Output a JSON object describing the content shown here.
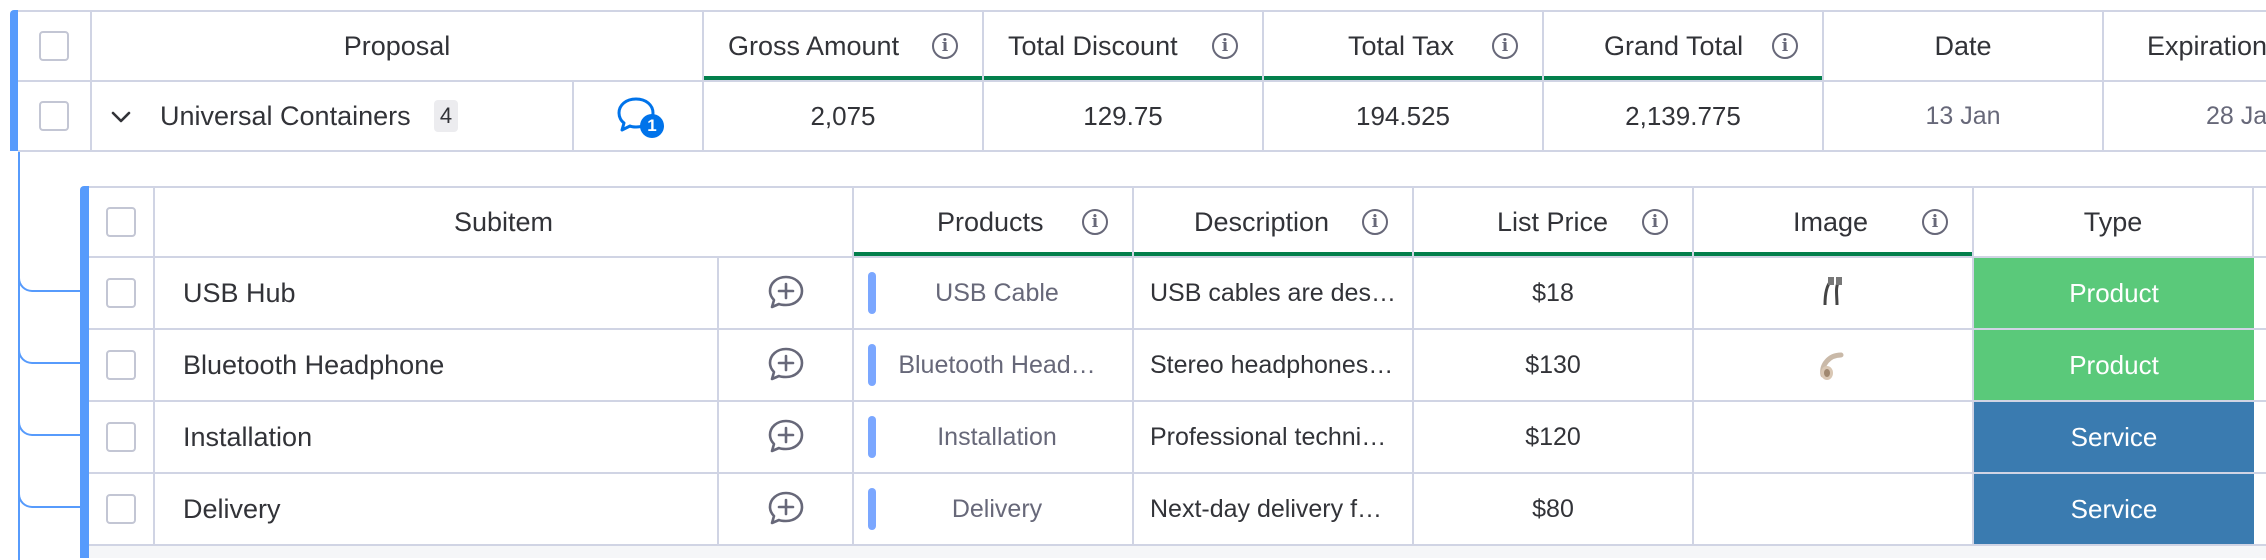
{
  "parent_table": {
    "headers": {
      "proposal": "Proposal",
      "gross_amount": "Gross Amount",
      "total_discount": "Total Discount",
      "total_tax": "Total Tax",
      "grand_total": "Grand Total",
      "date": "Date",
      "expiration": "Expiration"
    },
    "row": {
      "name": "Universal Containers",
      "subitem_count": "4",
      "updates_count": "1",
      "gross_amount": "2,075",
      "total_discount": "129.75",
      "total_tax": "194.525",
      "grand_total": "2,139.775",
      "date": "13 Jan",
      "expiration": "28 Ja"
    }
  },
  "sub_table": {
    "headers": {
      "subitem": "Subitem",
      "products": "Products",
      "description": "Description",
      "list_price": "List Price",
      "image": "Image",
      "type": "Type"
    },
    "rows": [
      {
        "name": "USB Hub",
        "product": "USB Cable",
        "description": "USB cables are desi…",
        "price": "$18",
        "image_icon": "usb-cable-thumbnail",
        "type": "Product",
        "type_color": "#5ac97a"
      },
      {
        "name": "Bluetooth Headphone",
        "product": "Bluetooth Head…",
        "description": "Stereo headphones…",
        "price": "$130",
        "image_icon": "headphone-thumbnail",
        "type": "Product",
        "type_color": "#5ac97a"
      },
      {
        "name": "Installation",
        "product": "Installation",
        "description": "Professional techni…",
        "price": "$120",
        "image_icon": "",
        "type": "Service",
        "type_color": "#3a7bb0"
      },
      {
        "name": "Delivery",
        "product": "Delivery",
        "description": "Next-day delivery f…",
        "price": "$80",
        "image_icon": "",
        "type": "Service",
        "type_color": "#3a7bb0"
      }
    ]
  },
  "colors": {
    "group_accent": "#579bfc",
    "summary_underline": "#037f4c",
    "product_bar": "#7ba7ff",
    "updates_icon": "#0073ea"
  }
}
